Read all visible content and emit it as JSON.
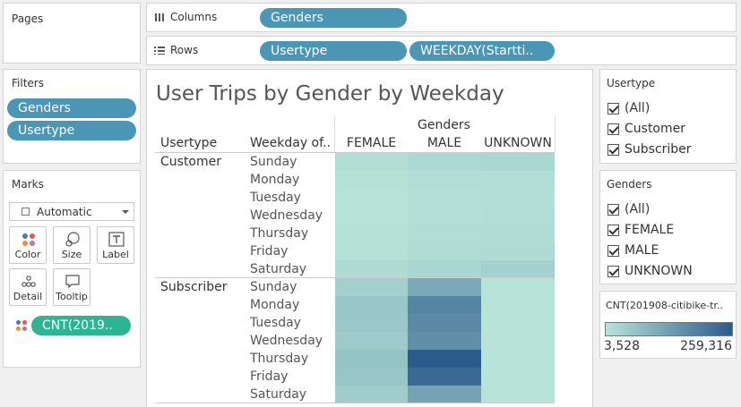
{
  "pages": {
    "title": "Pages"
  },
  "columns_shelf": {
    "label": "Columns",
    "pills": [
      "Genders"
    ]
  },
  "rows_shelf": {
    "label": "Rows",
    "pills": [
      "Usertype",
      "WEEKDAY(Startti.."
    ]
  },
  "filters": {
    "title": "Filters",
    "pills": [
      "Genders",
      "Usertype"
    ]
  },
  "marks": {
    "title": "Marks",
    "type_dropdown": "Automatic",
    "buttons": {
      "color": "Color",
      "size": "Size",
      "label": "Label",
      "detail": "Detail",
      "tooltip": "Tooltip"
    },
    "color_pill": "CNT(2019.."
  },
  "view": {
    "title": "User Trips by Gender by Weekday",
    "col_group_header": "Genders",
    "row_header_usertype": "Usertype",
    "row_header_weekday": "Weekday of..",
    "col_headers": [
      "FEMALE",
      "MALE",
      "UNKNOWN"
    ],
    "usertypes": [
      "Customer",
      "Subscriber"
    ],
    "weekdays": [
      "Sunday",
      "Monday",
      "Tuesday",
      "Wednesday",
      "Thursday",
      "Friday",
      "Saturday"
    ]
  },
  "usertype_filter": {
    "title": "Usertype",
    "options": [
      "(All)",
      "Customer",
      "Subscriber"
    ]
  },
  "genders_filter": {
    "title": "Genders",
    "options": [
      "(All)",
      "FEMALE",
      "MALE",
      "UNKNOWN"
    ]
  },
  "color_legend": {
    "title": "CNT(201908-citibike-tr..",
    "min_label": "3,528",
    "max_label": "259,316",
    "color_min": "#b7e3d8",
    "color_max": "#2b5b8c"
  },
  "chart_data": {
    "type": "heatmap",
    "title": "User Trips by Gender by Weekday",
    "columns": [
      "FEMALE",
      "MALE",
      "UNKNOWN"
    ],
    "rows": [
      {
        "usertype": "Customer",
        "weekday": "Sunday",
        "values": [
          14000,
          24000,
          26000
        ]
      },
      {
        "usertype": "Customer",
        "weekday": "Monday",
        "values": [
          7000,
          14000,
          14000
        ]
      },
      {
        "usertype": "Customer",
        "weekday": "Tuesday",
        "values": [
          5000,
          11000,
          12000
        ]
      },
      {
        "usertype": "Customer",
        "weekday": "Wednesday",
        "values": [
          5000,
          11000,
          14000
        ]
      },
      {
        "usertype": "Customer",
        "weekday": "Thursday",
        "values": [
          7000,
          14000,
          17000
        ]
      },
      {
        "usertype": "Customer",
        "weekday": "Friday",
        "values": [
          8000,
          16000,
          18000
        ]
      },
      {
        "usertype": "Customer",
        "weekday": "Saturday",
        "values": [
          19000,
          28000,
          38000
        ]
      },
      {
        "usertype": "Subscriber",
        "weekday": "Sunday",
        "values": [
          40000,
          112000,
          5000
        ]
      },
      {
        "usertype": "Subscriber",
        "weekday": "Monday",
        "values": [
          58000,
          180000,
          3528
        ]
      },
      {
        "usertype": "Subscriber",
        "weekday": "Tuesday",
        "values": [
          56000,
          172000,
          4000
        ]
      },
      {
        "usertype": "Subscriber",
        "weekday": "Wednesday",
        "values": [
          50000,
          162000,
          4000
        ]
      },
      {
        "usertype": "Subscriber",
        "weekday": "Thursday",
        "values": [
          64000,
          259316,
          4000
        ]
      },
      {
        "usertype": "Subscriber",
        "weekday": "Friday",
        "values": [
          60000,
          232000,
          4000
        ]
      },
      {
        "usertype": "Subscriber",
        "weekday": "Saturday",
        "values": [
          46000,
          124000,
          5000
        ]
      }
    ],
    "color_range": [
      3528,
      259316
    ]
  }
}
